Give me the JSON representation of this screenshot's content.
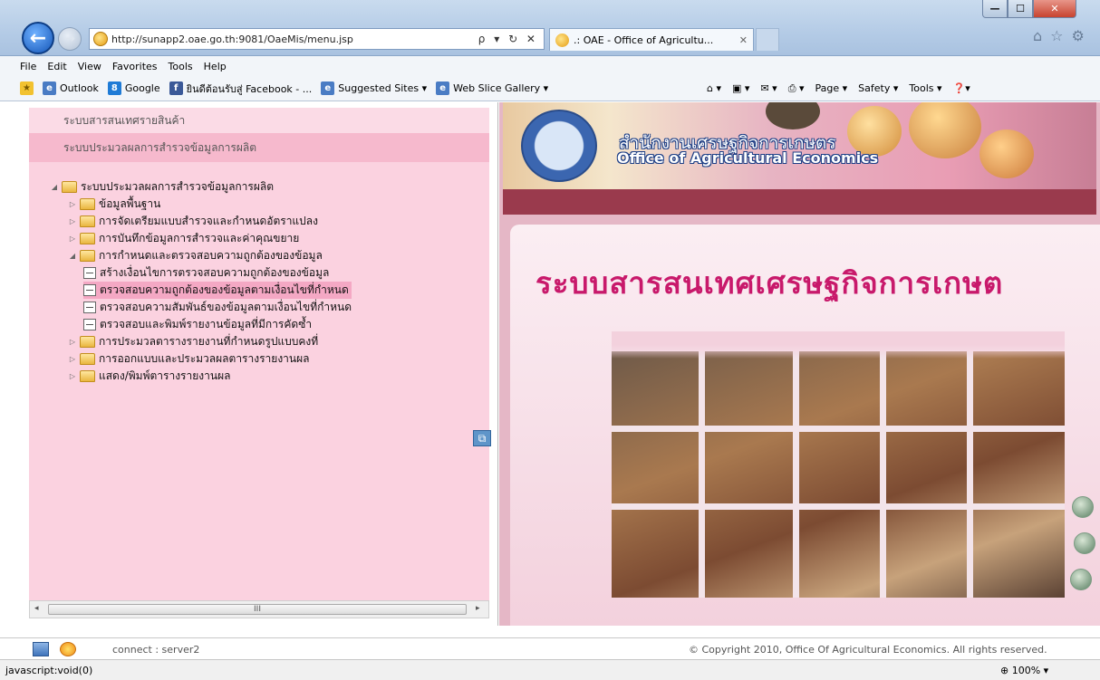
{
  "browser": {
    "url": "http://sunapp2.oae.go.th:9081/OaeMis/menu.jsp",
    "tab_title": ".: OAE - Office of Agricultu...",
    "address_controls": "ρ ▾ ↻ ✕",
    "menu": [
      "File",
      "Edit",
      "View",
      "Favorites",
      "Tools",
      "Help"
    ],
    "favorites": [
      "Outlook",
      "Google",
      "ยินดีต้อนรับสู่ Facebook - ...",
      "Suggested Sites ▾",
      "Web Slice Gallery ▾"
    ],
    "command_bar": [
      "Page ▾",
      "Safety ▾",
      "Tools ▾"
    ],
    "zoom": "100%",
    "status": "javascript:void(0)"
  },
  "left_menu": {
    "top_item": "ระบบสารสนเทศรายสินค้า",
    "second_item": "ระบบประมวลผลการสำรวจข้อมูลการผลิต",
    "tree": {
      "root": "ระบบประมวลผลการสำรวจข้อมูลการผลิต",
      "items": [
        "ข้อมูลพื้นฐาน",
        "การจัดเตรียมแบบสำรวจและกำหนดอัตราแปลง",
        "การบันทึกข้อมูลการสำรวจและค่าคุณขยาย",
        "การกำหนดและตรวจสอบความถูกต้องของข้อมูล"
      ],
      "subitems": [
        "สร้างเงื่อนไขการตรวจสอบความถูกต้องของข้อมูล",
        "ตรวจสอบความถูกต้องของข้อมูลตามเงื่อนไขที่กำหนด",
        "ตรวจสอบความสัมพันธ์ของข้อมูลตามเงื่อนไขที่กำหนด",
        "ตรวจสอบและพิมพ์รายงานข้อมูลที่มีการคัดซ้ำ"
      ],
      "more_items": [
        "การประมวลตารางรายงานที่กำหนดรูปแบบคงที่",
        "การออกแบบและประมวลผลตารางรายงานผล",
        "แสดง/พิมพ์ตารางรายงานผล"
      ]
    },
    "scroll_thumb": "III"
  },
  "banner": {
    "title_th": "สำนักงานเศรษฐกิจการเกษตร",
    "title_en": "Office of Agricultural Economics"
  },
  "content": {
    "headline": "ระบบสารสนเทศเศรษฐกิจการเกษต"
  },
  "footer": {
    "connect": "connect : server2",
    "copyright": "© Copyright 2010, Office Of Agricultural Economics. All rights reserved."
  }
}
